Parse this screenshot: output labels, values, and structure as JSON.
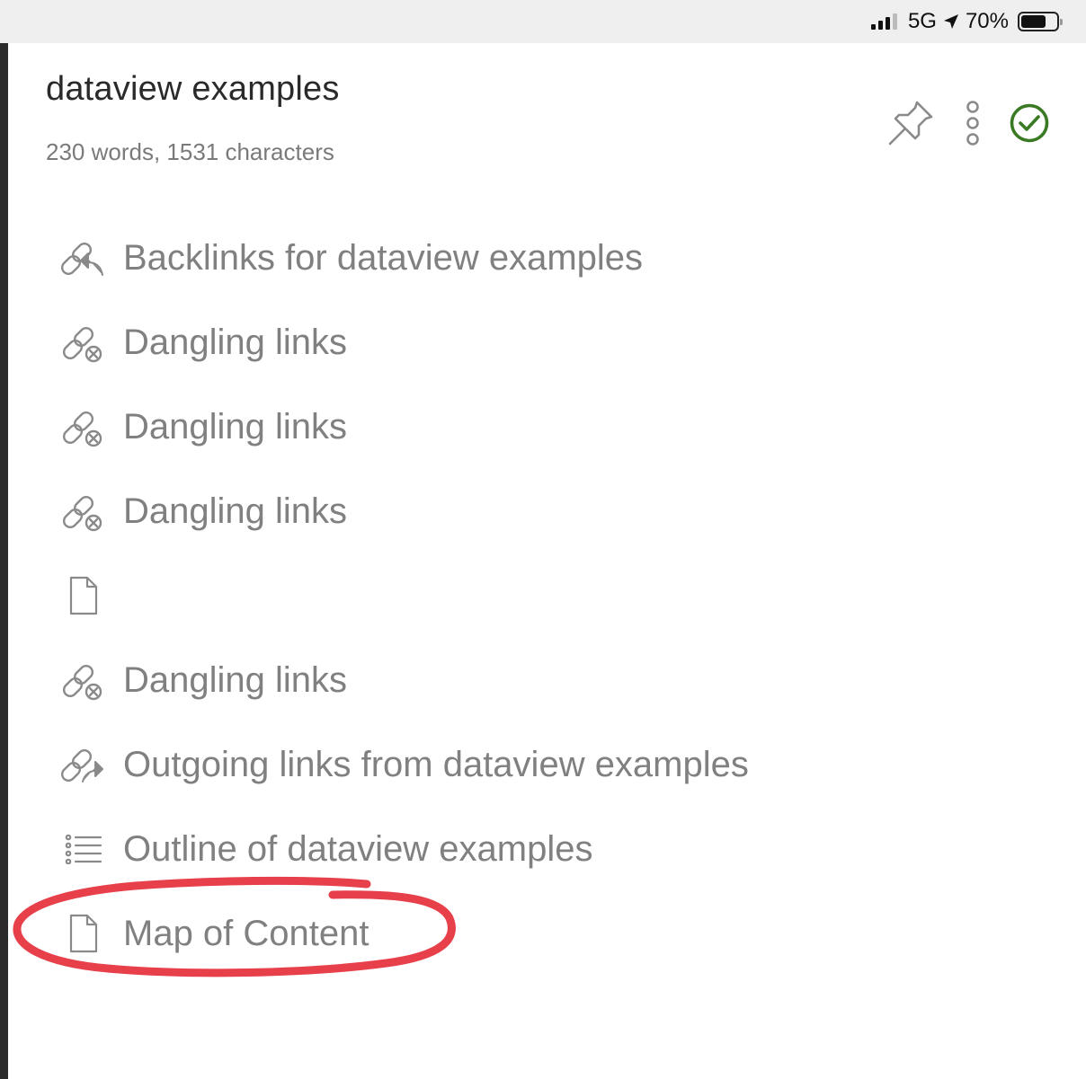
{
  "status_bar": {
    "network": "5G",
    "battery": "70%"
  },
  "header": {
    "title": "dataview examples",
    "stats": "230 words, 1531 characters"
  },
  "actions": {
    "pin_icon": "pin-icon",
    "more_icon": "more-vertical-icon",
    "status_icon": "check-circle-icon",
    "status_color": "#3a7a24"
  },
  "items": [
    {
      "label": "Backlinks for dataview examples",
      "icon": "backlink-icon"
    },
    {
      "label": "Dangling links",
      "icon": "dangling-link-icon"
    },
    {
      "label": "Dangling links",
      "icon": "dangling-link-icon"
    },
    {
      "label": "Dangling links",
      "icon": "dangling-link-icon"
    },
    {
      "label": "",
      "icon": "file-icon"
    },
    {
      "label": "Dangling links",
      "icon": "dangling-link-icon"
    },
    {
      "label": "Outgoing links from dataview examples",
      "icon": "outgoing-link-icon"
    },
    {
      "label": "Outline of dataview examples",
      "icon": "outline-icon"
    },
    {
      "label": "Map of Content",
      "icon": "file-icon"
    }
  ],
  "annotation": {
    "color": "#e8404a",
    "target": "Map of Content"
  }
}
